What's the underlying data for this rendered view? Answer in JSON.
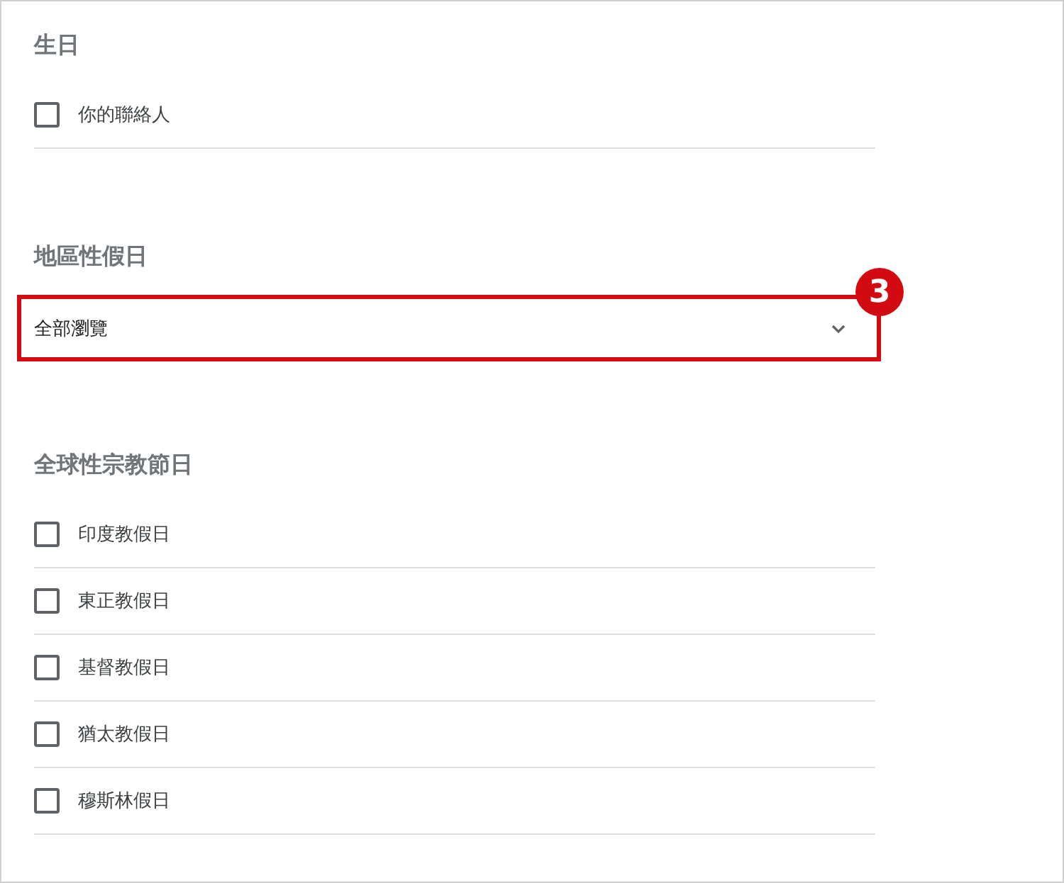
{
  "sections": [
    {
      "kind": "checklist",
      "title": "生日",
      "items": [
        {
          "label": "你的聯絡人",
          "checked": false
        }
      ]
    },
    {
      "kind": "dropdown",
      "title": "地區性假日",
      "value": "全部瀏覽",
      "annotation": {
        "label": "3"
      }
    },
    {
      "kind": "checklist",
      "title": "全球性宗教節日",
      "items": [
        {
          "label": "印度教假日",
          "checked": false
        },
        {
          "label": "東正教假日",
          "checked": false
        },
        {
          "label": "基督教假日",
          "checked": false
        },
        {
          "label": "猶太教假日",
          "checked": false
        },
        {
          "label": "穆斯林假日",
          "checked": false
        }
      ]
    }
  ]
}
